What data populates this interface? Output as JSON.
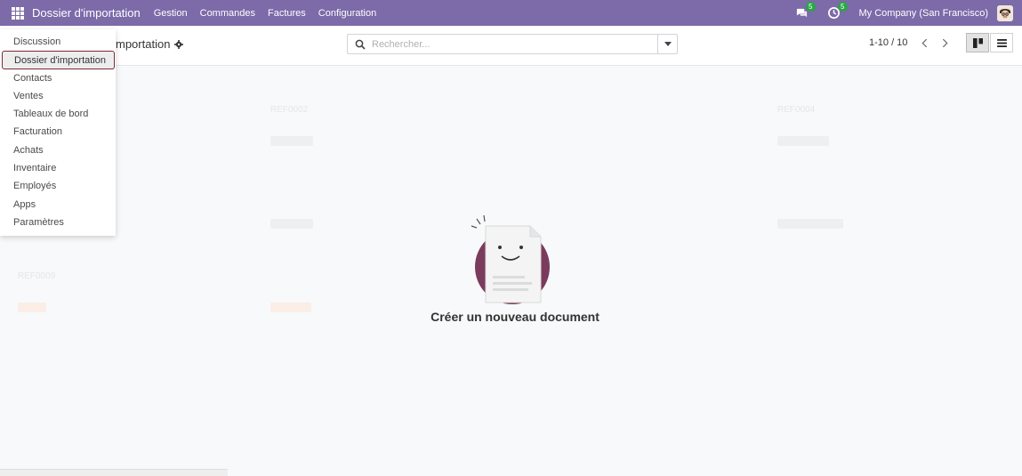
{
  "navbar": {
    "app_name": "Dossier d'importation",
    "menus": [
      "Gestion",
      "Commandes",
      "Factures",
      "Configuration"
    ],
    "messages_badge": "5",
    "activities_badge": "5",
    "company": "My Company (San Francisco)",
    "accent_color": "#7c6aa9"
  },
  "control_panel": {
    "title_visible": "mportation",
    "search_placeholder": "Rechercher...",
    "pager": "1-10 / 10",
    "views": [
      "kanban",
      "list"
    ],
    "active_view": "kanban"
  },
  "app_menu": {
    "items": [
      "Discussion",
      "Dossier d'importation",
      "Contacts",
      "Ventes",
      "Tableaux de bord",
      "Facturation",
      "Achats",
      "Inventaire",
      "Employés",
      "Apps",
      "Paramètres"
    ],
    "selected": "Dossier d'importation"
  },
  "empty_state": {
    "title": "Créer un nouveau document"
  },
  "ghost_cards": [
    "REF0002",
    "REF0004",
    "REF0009"
  ]
}
